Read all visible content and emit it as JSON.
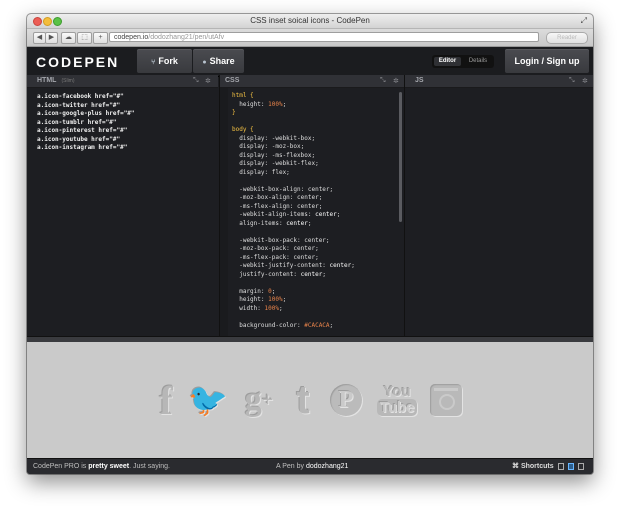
{
  "window": {
    "title": "CSS inset soical icons - CodePen"
  },
  "browser": {
    "url_host": "codepen.io",
    "url_path": "/dodozhang21/pen/utAfv",
    "reader_label": "Reader",
    "back_icon": "back-arrow-icon",
    "forward_icon": "forward-arrow-icon"
  },
  "header": {
    "logo": "CODEPEN",
    "fork_label": "Fork",
    "share_label": "Share",
    "editor_label": "Editor",
    "details_label": "Details",
    "login_label": "Login / Sign up"
  },
  "panes": {
    "html": {
      "title": "HTML",
      "sub": "(Slim)"
    },
    "css": {
      "title": "CSS"
    },
    "js": {
      "title": "JS"
    }
  },
  "html_code": [
    "a.icon-facebook href=\"#\"",
    "a.icon-twitter href=\"#\"",
    "a.icon-google-plus href=\"#\"",
    "a.icon-tumblr href=\"#\"",
    "a.icon-pinterest href=\"#\"",
    "a.icon-youtube href=\"#\"",
    "a.icon-instagram href=\"#\""
  ],
  "css_code": [
    [
      [
        "sel",
        "html {"
      ]
    ],
    [
      [
        "prop",
        "  height: "
      ],
      [
        "val",
        "100%"
      ],
      [
        "prop",
        ";"
      ]
    ],
    [
      [
        "sel",
        "}"
      ]
    ],
    [
      [
        "prop",
        ""
      ]
    ],
    [
      [
        "sel",
        "body {"
      ]
    ],
    [
      [
        "prop",
        "  display: -webkit-box;"
      ]
    ],
    [
      [
        "prop",
        "  display: -moz-box;"
      ]
    ],
    [
      [
        "prop",
        "  display: -ms-flexbox;"
      ]
    ],
    [
      [
        "prop",
        "  display: -webkit-flex;"
      ]
    ],
    [
      [
        "prop",
        "  display: flex;"
      ]
    ],
    [
      [
        "prop",
        ""
      ]
    ],
    [
      [
        "prop",
        "  -webkit-box-align: center;"
      ]
    ],
    [
      [
        "prop",
        "  -moz-box-align: center;"
      ]
    ],
    [
      [
        "prop",
        "  -ms-flex-align: center;"
      ]
    ],
    [
      [
        "prop",
        "  -webkit-align-items: "
      ],
      [
        "kw",
        "center"
      ],
      [
        "prop",
        ";"
      ]
    ],
    [
      [
        "prop",
        "  align-items: "
      ],
      [
        "kw",
        "center"
      ],
      [
        "prop",
        ";"
      ]
    ],
    [
      [
        "prop",
        ""
      ]
    ],
    [
      [
        "prop",
        "  -webkit-box-pack: center;"
      ]
    ],
    [
      [
        "prop",
        "  -moz-box-pack: center;"
      ]
    ],
    [
      [
        "prop",
        "  -ms-flex-pack: center;"
      ]
    ],
    [
      [
        "prop",
        "  -webkit-justify-content: "
      ],
      [
        "kw",
        "center"
      ],
      [
        "prop",
        ";"
      ]
    ],
    [
      [
        "prop",
        "  justify-content: "
      ],
      [
        "kw",
        "center"
      ],
      [
        "prop",
        ";"
      ]
    ],
    [
      [
        "prop",
        ""
      ]
    ],
    [
      [
        "prop",
        "  margin: "
      ],
      [
        "val",
        "0"
      ],
      [
        "prop",
        ";"
      ]
    ],
    [
      [
        "prop",
        "  height: "
      ],
      [
        "val",
        "100%"
      ],
      [
        "prop",
        ";"
      ]
    ],
    [
      [
        "prop",
        "  width: "
      ],
      [
        "val",
        "100%"
      ],
      [
        "prop",
        ";"
      ]
    ],
    [
      [
        "prop",
        ""
      ]
    ],
    [
      [
        "prop",
        "  background-color: "
      ],
      [
        "val",
        "#CACACA"
      ],
      [
        "prop",
        ";"
      ]
    ]
  ],
  "social_icons": [
    {
      "name": "facebook-icon",
      "glyph": "f"
    },
    {
      "name": "twitter-icon",
      "glyph": "🐦"
    },
    {
      "name": "google-plus-icon",
      "glyph": "g+"
    },
    {
      "name": "tumblr-icon",
      "glyph": "t"
    },
    {
      "name": "pinterest-icon",
      "glyph": "P"
    },
    {
      "name": "youtube-icon",
      "glyph": "You Tube"
    },
    {
      "name": "instagram-icon",
      "glyph": "◙"
    }
  ],
  "footer": {
    "pro_prefix": "CodePen PRO is",
    "pro_strong": "pretty sweet",
    "pro_suffix": ". Just saying.",
    "pen_prefix": "A Pen by",
    "pen_author": "dodozhang21",
    "shortcuts_label": "⌘ Shortcuts"
  },
  "colors": {
    "preview_bg": "#CACACA",
    "code_value": "#e8834a",
    "code_selector": "#f6c344"
  }
}
